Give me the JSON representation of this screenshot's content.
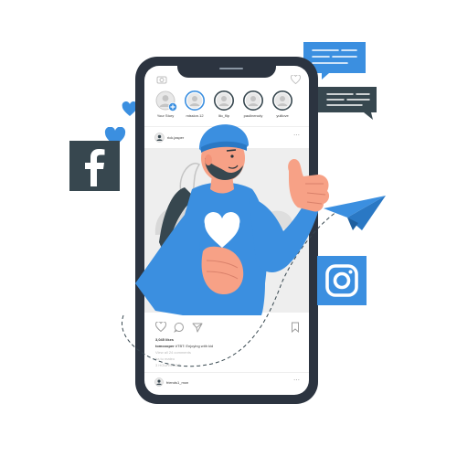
{
  "colors": {
    "accent": "#3b8fe0",
    "frame": "#2c3440",
    "dark_icon": "#37474f",
    "screen": "#ffffff",
    "feed_bg": "#eeeeee"
  },
  "stories": [
    {
      "label": "Your Story",
      "has_add_badge": true,
      "ring_color": "#c9c9c9"
    },
    {
      "label": "mission.12",
      "has_add_badge": false,
      "ring_color": "#3b8fe0"
    },
    {
      "label": "lilo_flip",
      "has_add_badge": false,
      "ring_color": "#37474f"
    },
    {
      "label": "paulinerudy",
      "has_add_badge": false,
      "ring_color": "#37474f"
    },
    {
      "label": "yulilove",
      "has_add_badge": false,
      "ring_color": "#37474f"
    }
  ],
  "post": {
    "username": "rick.jasper",
    "likes": "3,045 likes",
    "caption_user": "tomcooper",
    "caption_text": "#TBT: Enjoying with kid",
    "comments_link": "View all 24 comments",
    "comment_line": "ha tu mateo",
    "time": "3 HOURS AGO"
  },
  "next_post": {
    "username": "friends1_mon"
  },
  "icons": {
    "facebook": "facebook-icon",
    "instagram": "instagram-icon",
    "paper_plane": "paper-plane-icon",
    "hearts": "heart-icon",
    "camera": "camera-icon"
  }
}
